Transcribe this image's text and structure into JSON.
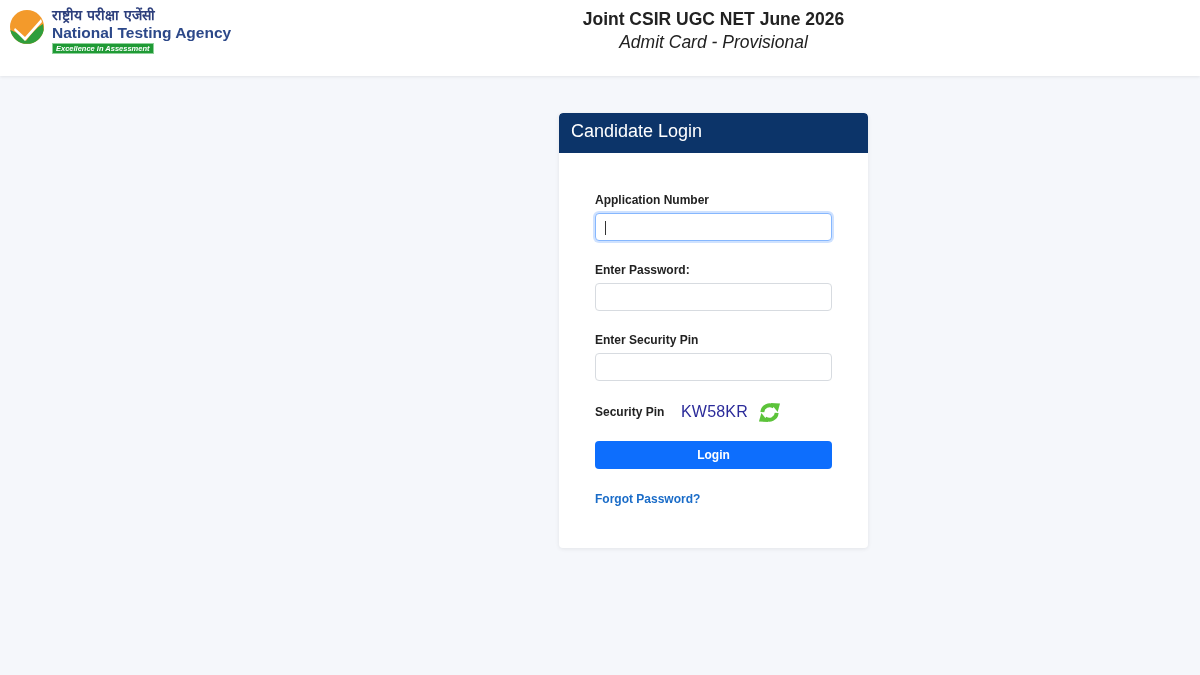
{
  "header": {
    "logo": {
      "hindi_name": "राष्ट्रीय परीक्षा एजेंसी",
      "name": "National Testing Agency",
      "tagline": "Excellence in Assessment"
    },
    "title": "Joint CSIR UGC NET June 2026",
    "subtitle": "Admit Card - Provisional"
  },
  "login_card": {
    "title": "Candidate Login",
    "fields": [
      {
        "label": "Application Number",
        "focused": true
      },
      {
        "label": "Enter Password:",
        "focused": false
      },
      {
        "label": "Enter Security Pin",
        "focused": false
      }
    ],
    "security_pin": {
      "label": "Security Pin",
      "code": "KW58KR"
    },
    "login_button": "Login",
    "forgot_password_link": "Forgot Password?"
  }
}
